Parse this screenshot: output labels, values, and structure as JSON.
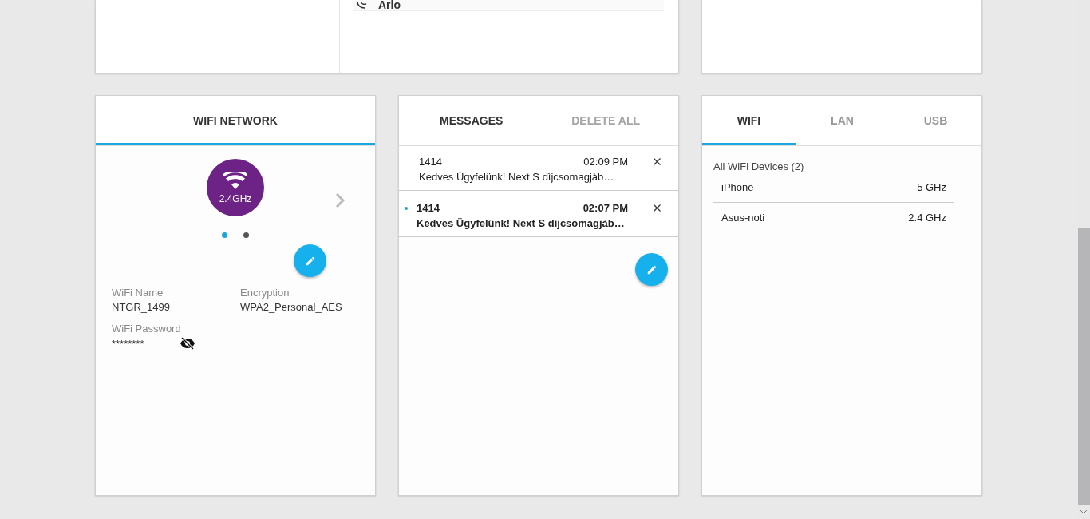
{
  "top_cards": {
    "device_list": [
      {
        "name": "Arlo"
      }
    ]
  },
  "wifi_network": {
    "title": "WIFI NETWORK",
    "band": "2.4GHz",
    "pages": [
      {
        "selected": true
      },
      {
        "selected": false
      }
    ],
    "fields": [
      {
        "label": "WiFi Name",
        "value": "NTGR_1499"
      },
      {
        "label": "Encryption",
        "value": "WPA2_Personal_AES"
      },
      {
        "label": "WiFi Password",
        "value": "********",
        "kind": "password"
      }
    ]
  },
  "messages": {
    "title": "MESSAGES",
    "delete_all": {
      "label": "DELETE ALL",
      "disabled": true
    },
    "items": [
      {
        "sender": "1414",
        "time": "02:09 PM",
        "text": "Kedves Ügyfelünk! Next S dìjcsomagjàb…",
        "unread": false
      },
      {
        "sender": "1414",
        "time": "02:07 PM",
        "text": "Kedves Ügyfelünk! Next S dìjcsomagjàb…",
        "unread": true
      }
    ]
  },
  "devices": {
    "tabs": [
      {
        "label": "WIFI",
        "selected": true
      },
      {
        "label": "LAN",
        "selected": false
      },
      {
        "label": "USB",
        "selected": false
      }
    ],
    "group": "All WiFi Devices (2)",
    "rows": [
      {
        "name": "iPhone",
        "band": "5 GHz"
      },
      {
        "name": "Asus-noti",
        "band": "2.4 GHz"
      }
    ]
  }
}
